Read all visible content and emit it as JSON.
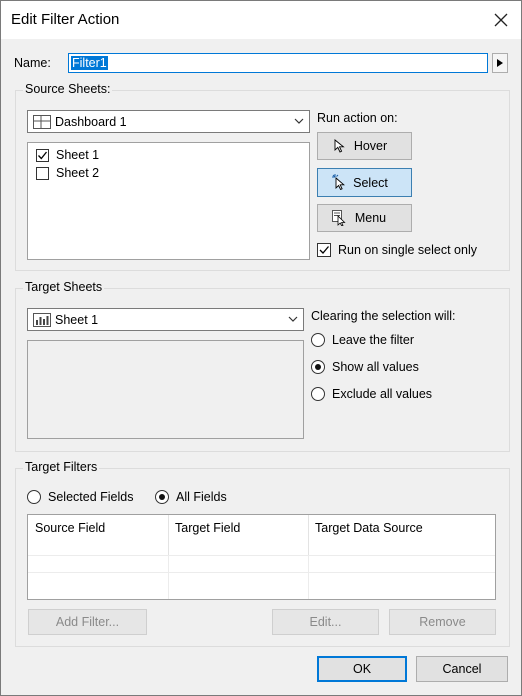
{
  "window": {
    "title": "Edit Filter Action"
  },
  "name_row": {
    "label": "Name:",
    "value": "Filter1"
  },
  "source": {
    "group_label": "Source Sheets:",
    "dashboard": "Dashboard 1",
    "sheets": [
      {
        "label": "Sheet 1",
        "checked": true
      },
      {
        "label": "Sheet 2",
        "checked": false
      }
    ],
    "run_action_label": "Run action on:",
    "hover": "Hover",
    "select": "Select",
    "menu": "Menu",
    "run_single": "Run on single select only"
  },
  "target": {
    "group_label": "Target Sheets",
    "sheet": "Sheet 1",
    "clearing_label": "Clearing the selection will:",
    "options": [
      "Leave the filter",
      "Show all values",
      "Exclude all values"
    ],
    "selected_option": "Show all values"
  },
  "filters": {
    "group_label": "Target Filters",
    "selected_fields": "Selected Fields",
    "all_fields": "All Fields",
    "columns": [
      "Source Field",
      "Target Field",
      "Target Data Source"
    ],
    "add_filter": "Add Filter...",
    "edit": "Edit...",
    "remove": "Remove"
  },
  "footer": {
    "ok": "OK",
    "cancel": "Cancel"
  }
}
